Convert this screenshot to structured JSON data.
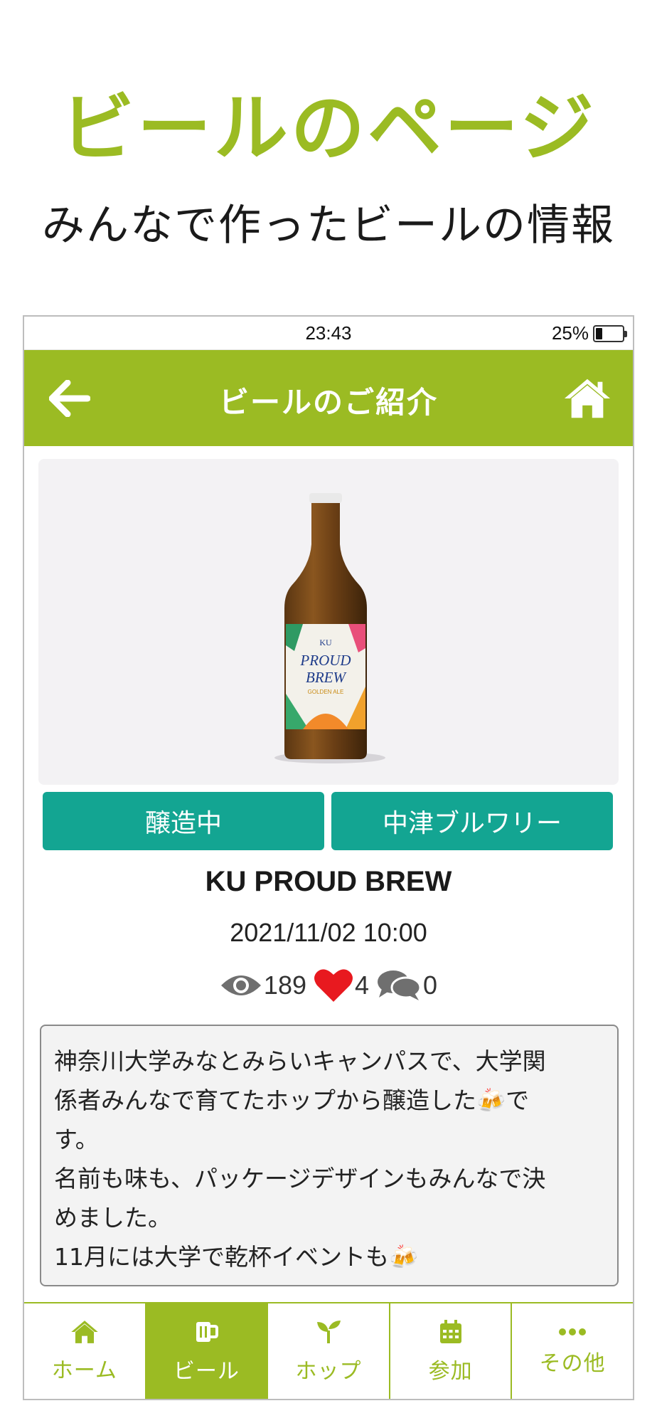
{
  "hero": {
    "title": "ビールのページ",
    "subtitle": "みんなで作ったビールの情報"
  },
  "status_bar": {
    "time": "23:43",
    "battery": "25%",
    "battery_level": 0.25
  },
  "header": {
    "title": "ビールのご紹介",
    "back_icon": "arrow-left-icon",
    "home_icon": "home-icon"
  },
  "beer": {
    "image_alt": "KU PROUD BREW bottle",
    "label_brand": "KU",
    "label_name_1": "PROUD",
    "label_name_2": "BREW",
    "label_style": "GOLDEN ALE",
    "status_tag": "醸造中",
    "brewery_tag": "中津ブルワリー",
    "name": "KU PROUD BREW",
    "date": "2021/11/02 10:00",
    "views": "189",
    "likes": "4",
    "comments": "0",
    "description_lines": [
      "神奈川大学みなとみらいキャンパスで、大学関",
      "係者みんなで育てたホップから醸造した🍻で",
      "す。",
      "名前も味も、パッケージデザインもみんなで決",
      "めました。",
      "11月には大学で乾杯イベントも🍻"
    ]
  },
  "tabs": [
    {
      "label": "ホーム",
      "icon": "home-icon",
      "active": false
    },
    {
      "label": "ビール",
      "icon": "beer-mug-icon",
      "active": true
    },
    {
      "label": "ホップ",
      "icon": "sprout-icon",
      "active": false
    },
    {
      "label": "参加",
      "icon": "calendar-icon",
      "active": false
    },
    {
      "label": "その他",
      "icon": "more-icon",
      "active": false
    }
  ],
  "colors": {
    "brand_green": "#9bbb23",
    "tag_teal": "#13a592",
    "heart_red": "#e8191f"
  }
}
